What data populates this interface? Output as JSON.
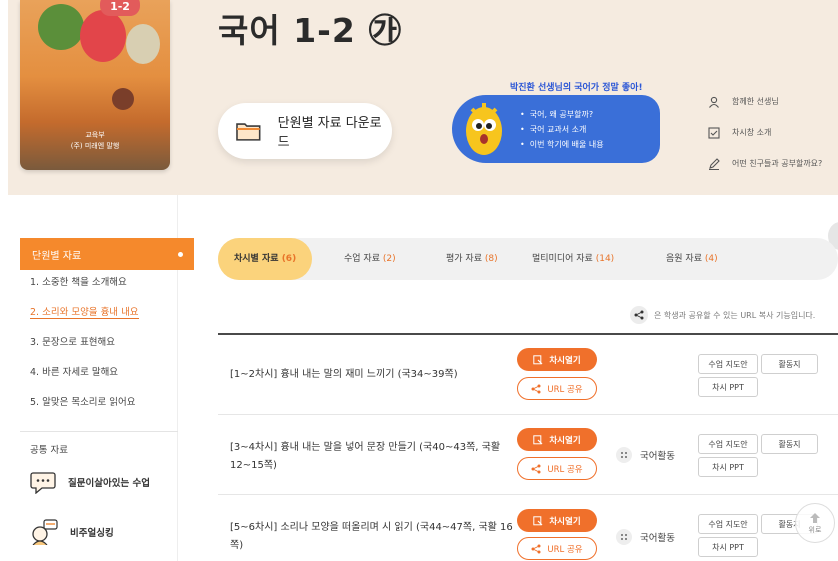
{
  "cover": {
    "grade_badge": "1-2",
    "publisher_line1": "교육부",
    "publisher_line2": "(주) 미래엔 말행"
  },
  "header": {
    "title": "국어 1-2 ㉮",
    "download_label": "단원별 자료 다운로드"
  },
  "promo": {
    "title": "박진환 선생님의 국어가 정말 좋아!",
    "items": [
      "국어, 왜 공부할까?",
      "국어 교과서 소개",
      "이번 학기에 배울 내용"
    ]
  },
  "side_links": [
    "함께한 선생님",
    "차시창 소개",
    "어떤 친구들과 공부할까요?"
  ],
  "left_nav": {
    "header": "단원별 자료",
    "units": [
      "1. 소중한 책을 소개해요",
      "2. 소리와 모양을 흉내 내요",
      "3. 문장으로 표현해요",
      "4. 바른 자세로 말해요",
      "5. 알맞은 목소리로 읽어요"
    ],
    "active_index": 1,
    "common": "공통 자료",
    "menu1": "질문이살아있는 수업",
    "menu2": "비주얼싱킹"
  },
  "tabs": [
    {
      "label": "차시별 자료",
      "count": "(6)"
    },
    {
      "label": "수업 자료",
      "count": "(2)"
    },
    {
      "label": "평가 자료",
      "count": "(8)"
    },
    {
      "label": "멀티미디어 자료",
      "count": "(14)"
    },
    {
      "label": "음원 자료",
      "count": "(4)"
    }
  ],
  "share_note": "은 학생과 공유할 수 있는 URL 복사 기능입니다.",
  "row_buttons": {
    "open": "차시열기",
    "share": "URL 공유",
    "guide": "수업 지도안",
    "worksheet": "활동지",
    "ppt": "차시 PPT",
    "activity": "국어활동"
  },
  "rows": [
    {
      "text": "[1~2차시] 흉내 내는 말의 재미 느끼기 (국34~39쪽)"
    },
    {
      "text": "[3~4차시] 흉내 내는 말을 넣어 문장 만들기 (국40~43쪽, 국활 12~15쪽)"
    },
    {
      "text": "[5~6차시] 소리나 모양을 떠올리며 시 읽기 (국44~47쪽, 국활 16쪽)"
    }
  ],
  "top_button": "위로",
  "colors": {
    "accent": "#f0702b",
    "nav_active": "#f5892c",
    "tab_active": "#fbd37c",
    "promo_blue": "#3a6fd8"
  }
}
